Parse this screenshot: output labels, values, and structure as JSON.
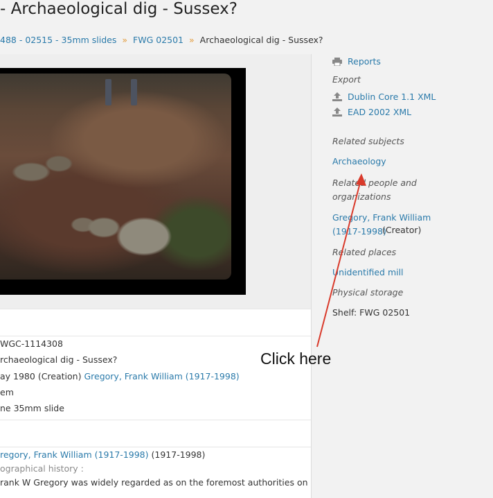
{
  "page": {
    "title": "- Archaeological dig - Sussex?"
  },
  "breadcrumb": {
    "items": [
      "488 - 02515 - 35mm slides",
      "FWG 02501"
    ],
    "current": "Archaeological dig - Sussex?"
  },
  "record": {
    "identifier": "WGC-1114308",
    "title": "rchaeological dig - Sussex?",
    "date": "ay 1980 (Creation)",
    "date_creator_link": "Gregory, Frank William (1917-1998)",
    "level": "em",
    "extent": "ne 35mm slide",
    "creator_link": "regory, Frank William (1917-1998)",
    "creator_dates": "(1917-1998)",
    "bio_label": "ographical history :",
    "bio_text": "rank W Gregory was widely regarded as on the foremost authorities on"
  },
  "sidebar": {
    "reports": "Reports",
    "export_label": "Export",
    "export_dc": "Dublin Core 1.1 XML",
    "export_ead": "EAD 2002 XML",
    "related_subjects_label": "Related subjects",
    "subject": "Archaeology",
    "related_people_label_1": "Related people and",
    "related_people_label_2": "organizations",
    "person_link_1": "Gregory, Frank William",
    "person_link_2": "(1917-1998)",
    "person_role": "(Creator)",
    "related_places_label": "Related places",
    "place": "Unidentified mill",
    "physical_storage_label": "Physical storage",
    "shelf": "Shelf: FWG 02501"
  },
  "annotation": {
    "text": "Click here",
    "color": "#d93a2b"
  },
  "icons": {
    "reports": "printer-icon",
    "export": "upload-icon"
  },
  "colors": {
    "link": "#2a7aaa",
    "separator": "#e39b3a",
    "background": "#f2f2f2"
  }
}
